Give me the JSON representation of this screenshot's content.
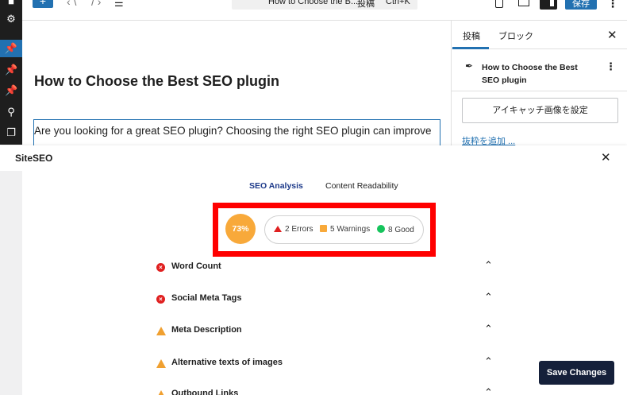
{
  "topbar": {
    "add_label": "+",
    "undo_icon": "undo-icon",
    "redo_icon": "redo-icon",
    "list_view_icon": "list-view-icon",
    "command_title": "How to Choose the B...",
    "command_type": "投稿",
    "command_shortcut": "Ctrl+K",
    "publish_label": "保存"
  },
  "admin_sidebar": {
    "icons": [
      "dashboard-icon",
      "settings-icon",
      "posts-icon",
      "pin-icon",
      "pin-icon",
      "seo-icon",
      "pages-icon"
    ]
  },
  "editor": {
    "post_title": "How to Choose the Best SEO plugin",
    "paragraph": "Are you looking for a great SEO plugin? Choosing the right SEO plugin can improve"
  },
  "settings_sidebar": {
    "tabs": [
      "投稿",
      "ブロック"
    ],
    "active_tab": "投稿",
    "document_title": "How to Choose the Best SEO plugin",
    "featured_image_label": "アイキャッチ画像を設定",
    "excerpt_link": "抜粋を追加 ..."
  },
  "seo_panel": {
    "title": "SiteSEO",
    "tabs": [
      {
        "label": "SEO Analysis",
        "active": true
      },
      {
        "label": "Content Readability",
        "active": false
      }
    ],
    "score": "73%",
    "summary": {
      "errors": "2 Errors",
      "warnings": "5 Warnings",
      "good": "8 Good"
    },
    "checks": [
      {
        "label": "Word Count",
        "status": "error"
      },
      {
        "label": "Social Meta Tags",
        "status": "error"
      },
      {
        "label": "Meta Description",
        "status": "warning"
      },
      {
        "label": "Alternative texts of images",
        "status": "warning"
      },
      {
        "label": "Outbound Links",
        "status": "warning"
      }
    ],
    "save_label": "Save Changes"
  },
  "colors": {
    "accent": "#2271b1",
    "score_orange": "#f8a93a",
    "error_red": "#e02020",
    "good_green": "#16c45c",
    "highlight_frame": "#ff0000",
    "save_button": "#15203a"
  }
}
